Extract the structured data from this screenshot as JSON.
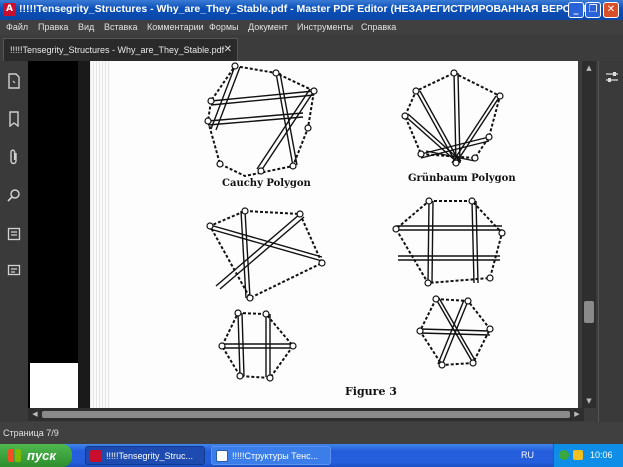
{
  "window": {
    "title": "!!!!!Tensegrity_Structures - Why_are_They_Stable.pdf - Master PDF Editor (НЕЗАРЕГИСТРИРОВАННАЯ ВЕРСИЯ)",
    "minimize": "_",
    "maximize": "❐",
    "close": "✕"
  },
  "menu": [
    "Файл",
    "Правка",
    "Вид",
    "Вставка",
    "Комментарии",
    "Формы",
    "Документ",
    "Инструменты",
    "Справка"
  ],
  "tab": {
    "label": "!!!!!Tensegrity_Structures - Why_are_They_Stable.pdf",
    "close": "✕"
  },
  "document": {
    "cauchy_label": "Cauchy  Polygon",
    "grunbaum_label": "Grünbaum  Polygon",
    "figure_label": "Figure 3"
  },
  "status": {
    "page_text": "Страница 7/9"
  },
  "taskbar": {
    "start": "пуск",
    "tasks": [
      {
        "label": "!!!!!Tensegrity_Struc...",
        "active": true
      },
      {
        "label": "!!!!!Структуры Тенс...",
        "active": false
      }
    ],
    "language": "RU",
    "clock": "10:06"
  }
}
